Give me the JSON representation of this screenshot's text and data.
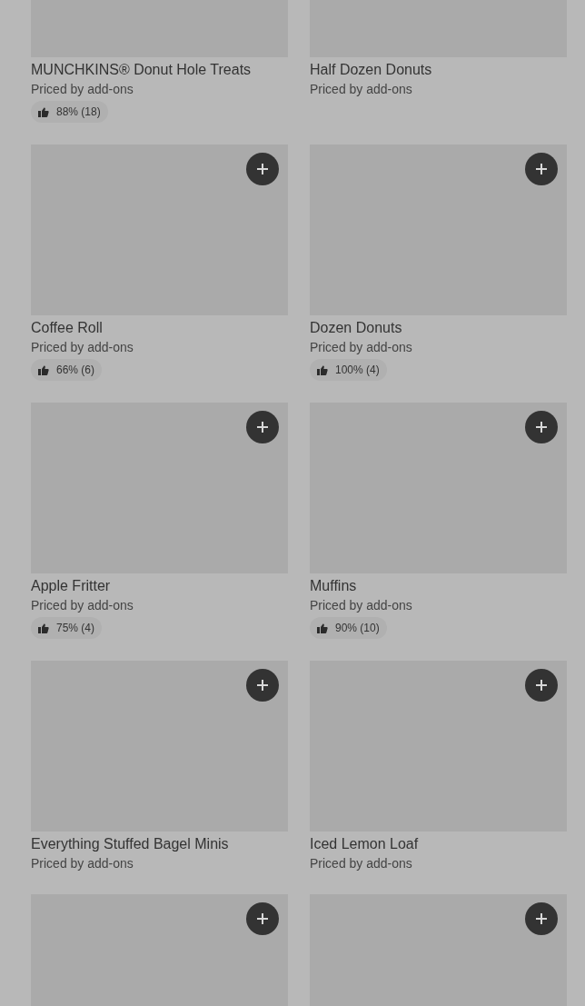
{
  "items": [
    {
      "name": "MUNCHKINS® Donut Hole Treats",
      "subtitle": "Priced by add-ons",
      "rating": "88% (18)",
      "add_button": false
    },
    {
      "name": "Half Dozen Donuts",
      "subtitle": "Priced by add-ons",
      "add_button": false
    },
    {
      "name": "Coffee Roll",
      "subtitle": "Priced by add-ons",
      "rating": "66% (6)",
      "add_button": true
    },
    {
      "name": "Dozen Donuts",
      "subtitle": "Priced by add-ons",
      "rating": "100% (4)",
      "add_button": true
    },
    {
      "name": "Apple Fritter",
      "subtitle": "Priced by add-ons",
      "rating": "75% (4)",
      "add_button": true
    },
    {
      "name": "Muffins",
      "subtitle": "Priced by add-ons",
      "rating": "90% (10)",
      "add_button": true
    },
    {
      "name": "Everything Stuffed Bagel Minis",
      "subtitle": "Priced by add-ons",
      "add_button": true
    },
    {
      "name": "Iced Lemon Loaf",
      "subtitle": "Priced by add-ons",
      "add_button": true
    },
    {
      "add_button": true
    },
    {
      "add_button": true
    }
  ]
}
